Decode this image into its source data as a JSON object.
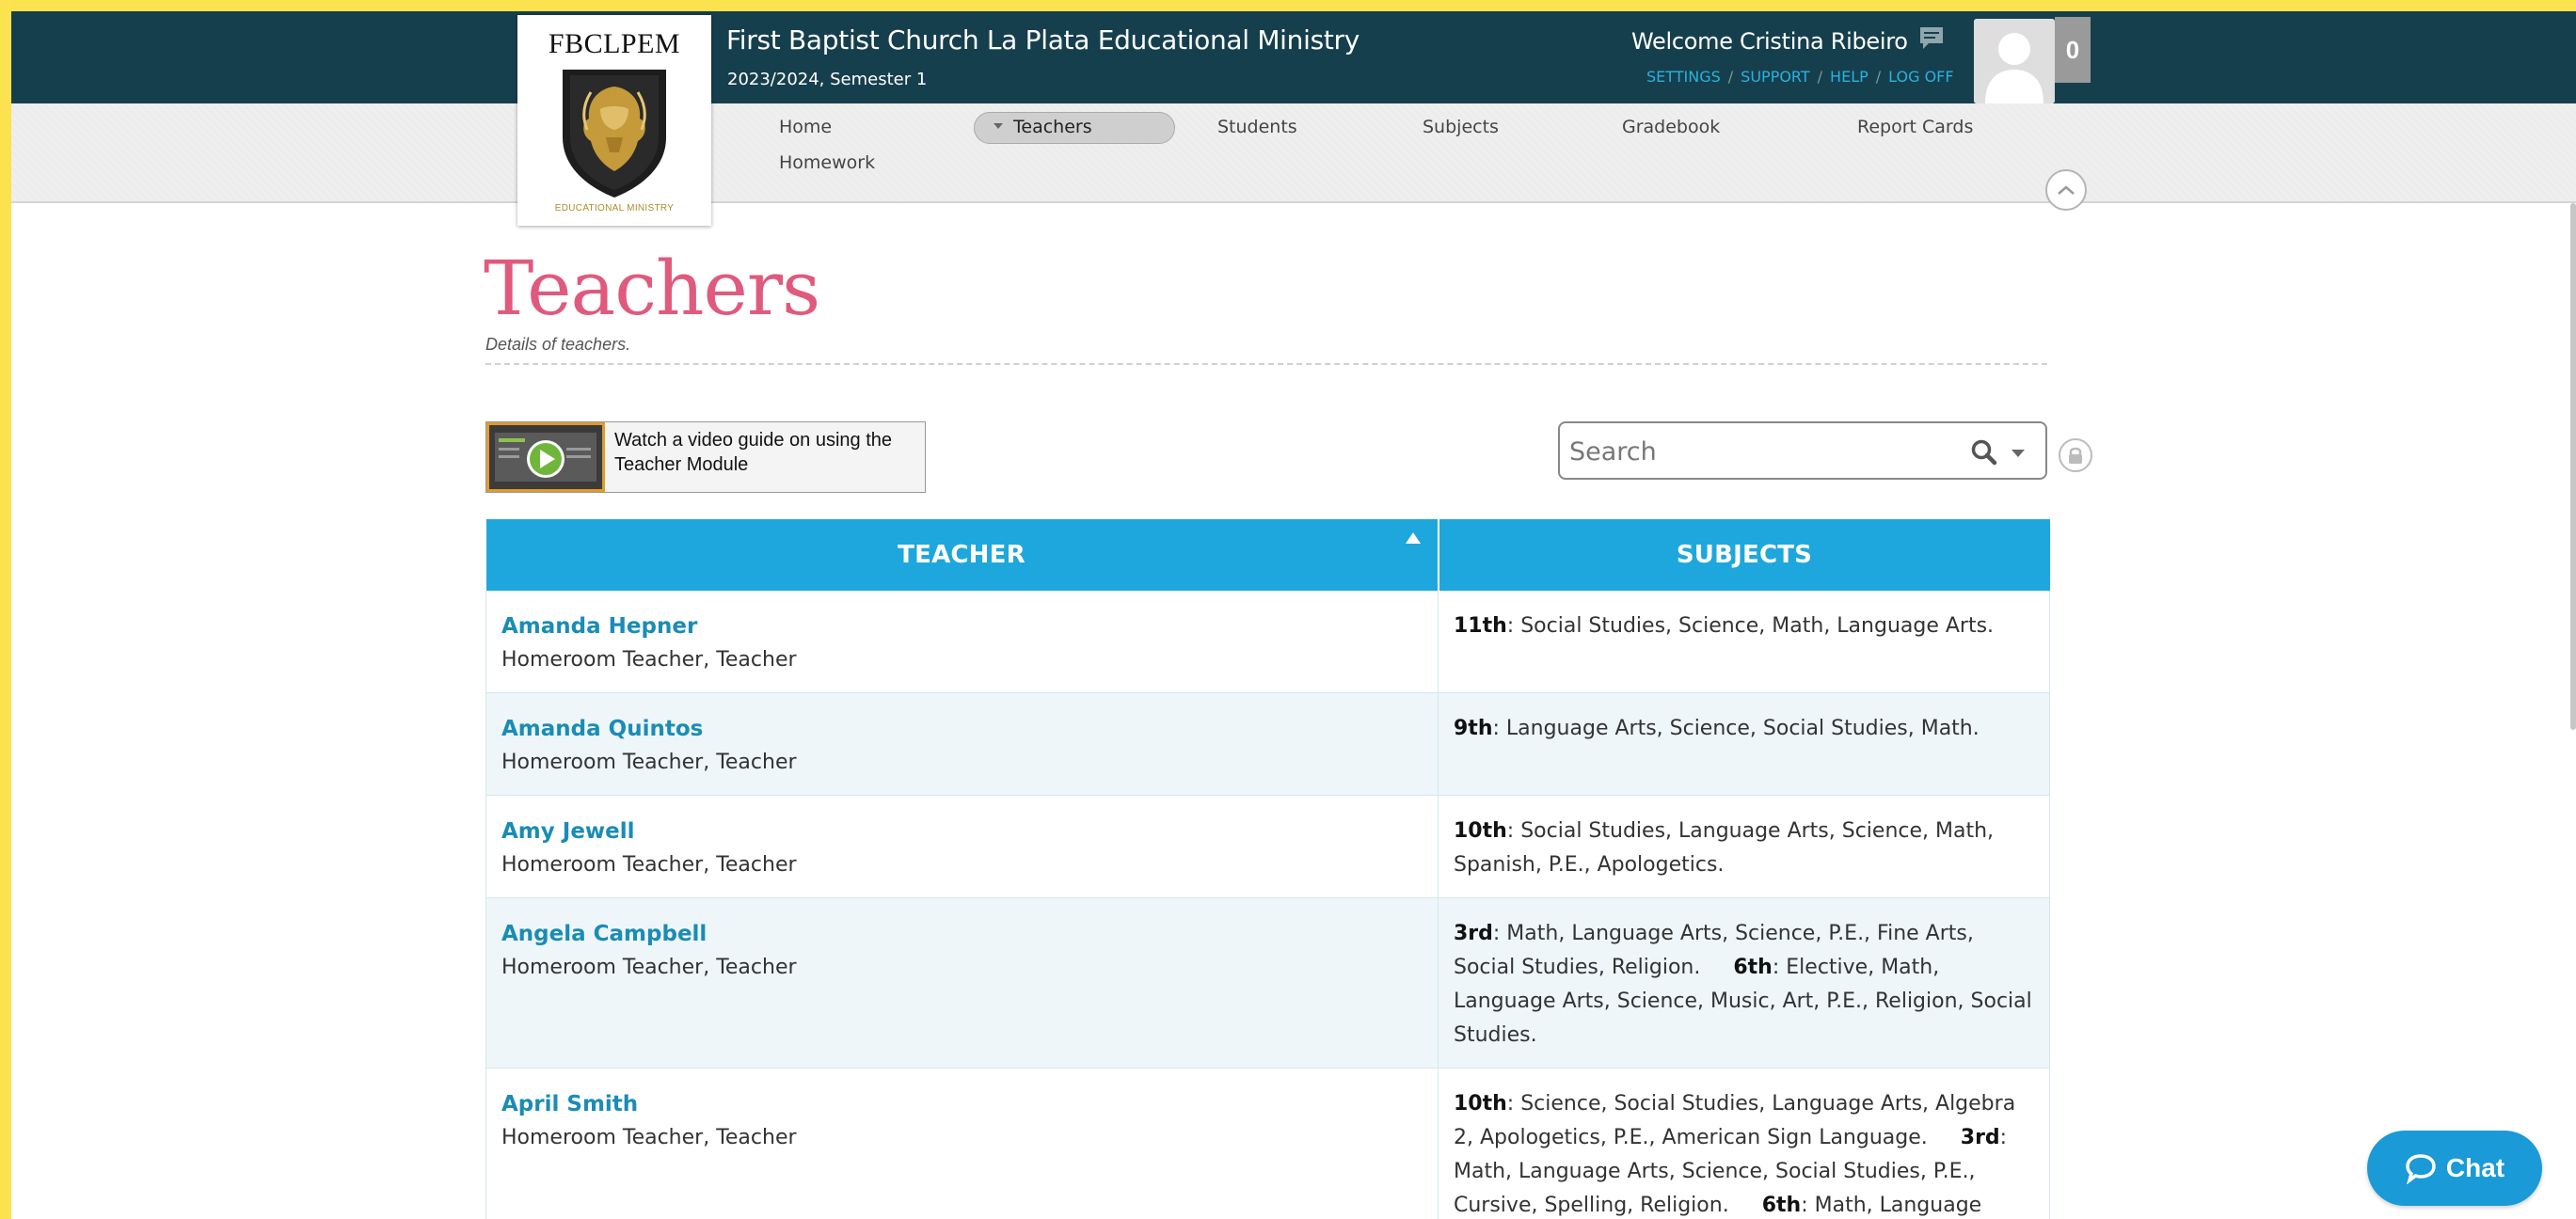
{
  "colors": {
    "border": "#fde24f",
    "topbar": "#163f4d",
    "title": "#e05a7e",
    "table_header": "#1ea7dc",
    "link": "#1a8cb5",
    "chat": "#1a9ad6"
  },
  "logo": {
    "title": "FBCLPEM",
    "subtitle": "EDUCATIONAL MINISTRY"
  },
  "header": {
    "school_name": "First Baptist Church La Plata Educational Ministry",
    "term": "2023/2024, Semester 1",
    "welcome": "Welcome Cristina Ribeiro",
    "links": [
      "SETTINGS",
      "SUPPORT",
      "HELP",
      "LOG OFF"
    ],
    "notification_count": "0"
  },
  "nav": {
    "items": [
      "Home",
      "Teachers",
      "Students",
      "Subjects",
      "Gradebook",
      "Report Cards",
      "Homework"
    ],
    "active": "Teachers"
  },
  "page": {
    "title": "Teachers",
    "subtitle": "Details of teachers."
  },
  "video_guide": {
    "line1": "Watch a video guide on using the",
    "line2": "Teacher Module"
  },
  "search": {
    "placeholder": "Search"
  },
  "table": {
    "columns": [
      "TEACHER",
      "SUBJECTS"
    ],
    "rows": [
      {
        "name": "Amanda Hepner",
        "role": "Homeroom Teacher, Teacher",
        "subjects": [
          {
            "grade": "11th",
            "list": ": Social Studies, Science, Math, Language Arts."
          }
        ]
      },
      {
        "name": "Amanda Quintos",
        "role": "Homeroom Teacher, Teacher",
        "subjects": [
          {
            "grade": "9th",
            "list": ": Language Arts, Science, Social Studies, Math."
          }
        ]
      },
      {
        "name": "Amy Jewell",
        "role": "Homeroom Teacher, Teacher",
        "subjects": [
          {
            "grade": "10th",
            "list": ": Social Studies, Language Arts, Science, Math, Spanish, P.E., Apologetics."
          }
        ]
      },
      {
        "name": "Angela Campbell",
        "role": "Homeroom Teacher, Teacher",
        "subjects": [
          {
            "grade": "3rd",
            "list": ": Math, Language Arts, Science, P.E., Fine Arts, Social Studies, Religion."
          },
          {
            "grade": "6th",
            "list": ": Elective, Math, Language Arts, Science, Music, Art, P.E., Religion, Social Studies."
          }
        ]
      },
      {
        "name": "April Smith",
        "role": "Homeroom Teacher, Teacher",
        "subjects": [
          {
            "grade": "10th",
            "list": ": Science, Social Studies, Language Arts, Algebra 2, Apologetics, P.E., American Sign Language."
          },
          {
            "grade": "3rd",
            "list": ": Math, Language Arts, Science, Social Studies, P.E., Cursive, Spelling, Religion."
          },
          {
            "grade": "6th",
            "list": ": Math, Language"
          }
        ]
      }
    ]
  },
  "chat": {
    "label": "Chat"
  }
}
